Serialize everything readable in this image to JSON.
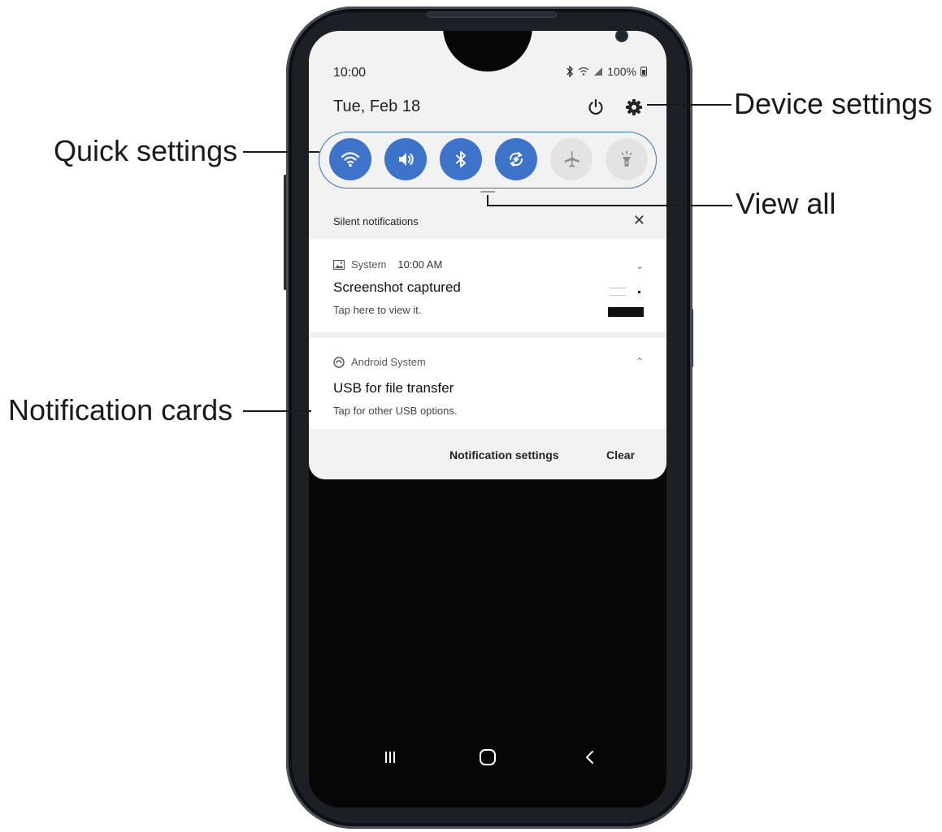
{
  "status_bar": {
    "time": "10:00",
    "battery": "100%",
    "icons": [
      "bluetooth-icon",
      "wifi-icon",
      "signal-icon",
      "battery-icon"
    ]
  },
  "panel": {
    "date": "Tue, Feb 18",
    "quick_settings": [
      {
        "name": "wifi",
        "icon": "wifi-icon",
        "state": "on"
      },
      {
        "name": "sound",
        "icon": "sound-icon",
        "state": "on"
      },
      {
        "name": "bluetooth",
        "icon": "bluetooth-icon",
        "state": "on"
      },
      {
        "name": "auto-rotate",
        "icon": "auto-rotate-icon",
        "state": "on"
      },
      {
        "name": "airplane-mode",
        "icon": "airplane-icon",
        "state": "off"
      },
      {
        "name": "flashlight",
        "icon": "flashlight-icon",
        "state": "off"
      }
    ]
  },
  "notifications": {
    "section_label": "Silent notifications",
    "cards": [
      {
        "app": "System",
        "time": "10:00 AM",
        "title": "Screenshot captured",
        "text": "Tap here to view it."
      },
      {
        "app": "Android System",
        "title": "USB for file transfer",
        "text": "Tap for other USB options."
      }
    ],
    "actions": {
      "settings": "Notification settings",
      "clear": "Clear"
    }
  },
  "callouts": {
    "device_settings": "Device settings",
    "quick_settings": "Quick settings",
    "view_all": "View all",
    "notification_cards": "Notification cards"
  },
  "colors": {
    "accent": "#3d73c9",
    "toggle_off": "#e3e3e3",
    "panel_bg": "#f2f2f2",
    "screen_bg": "#060606"
  }
}
